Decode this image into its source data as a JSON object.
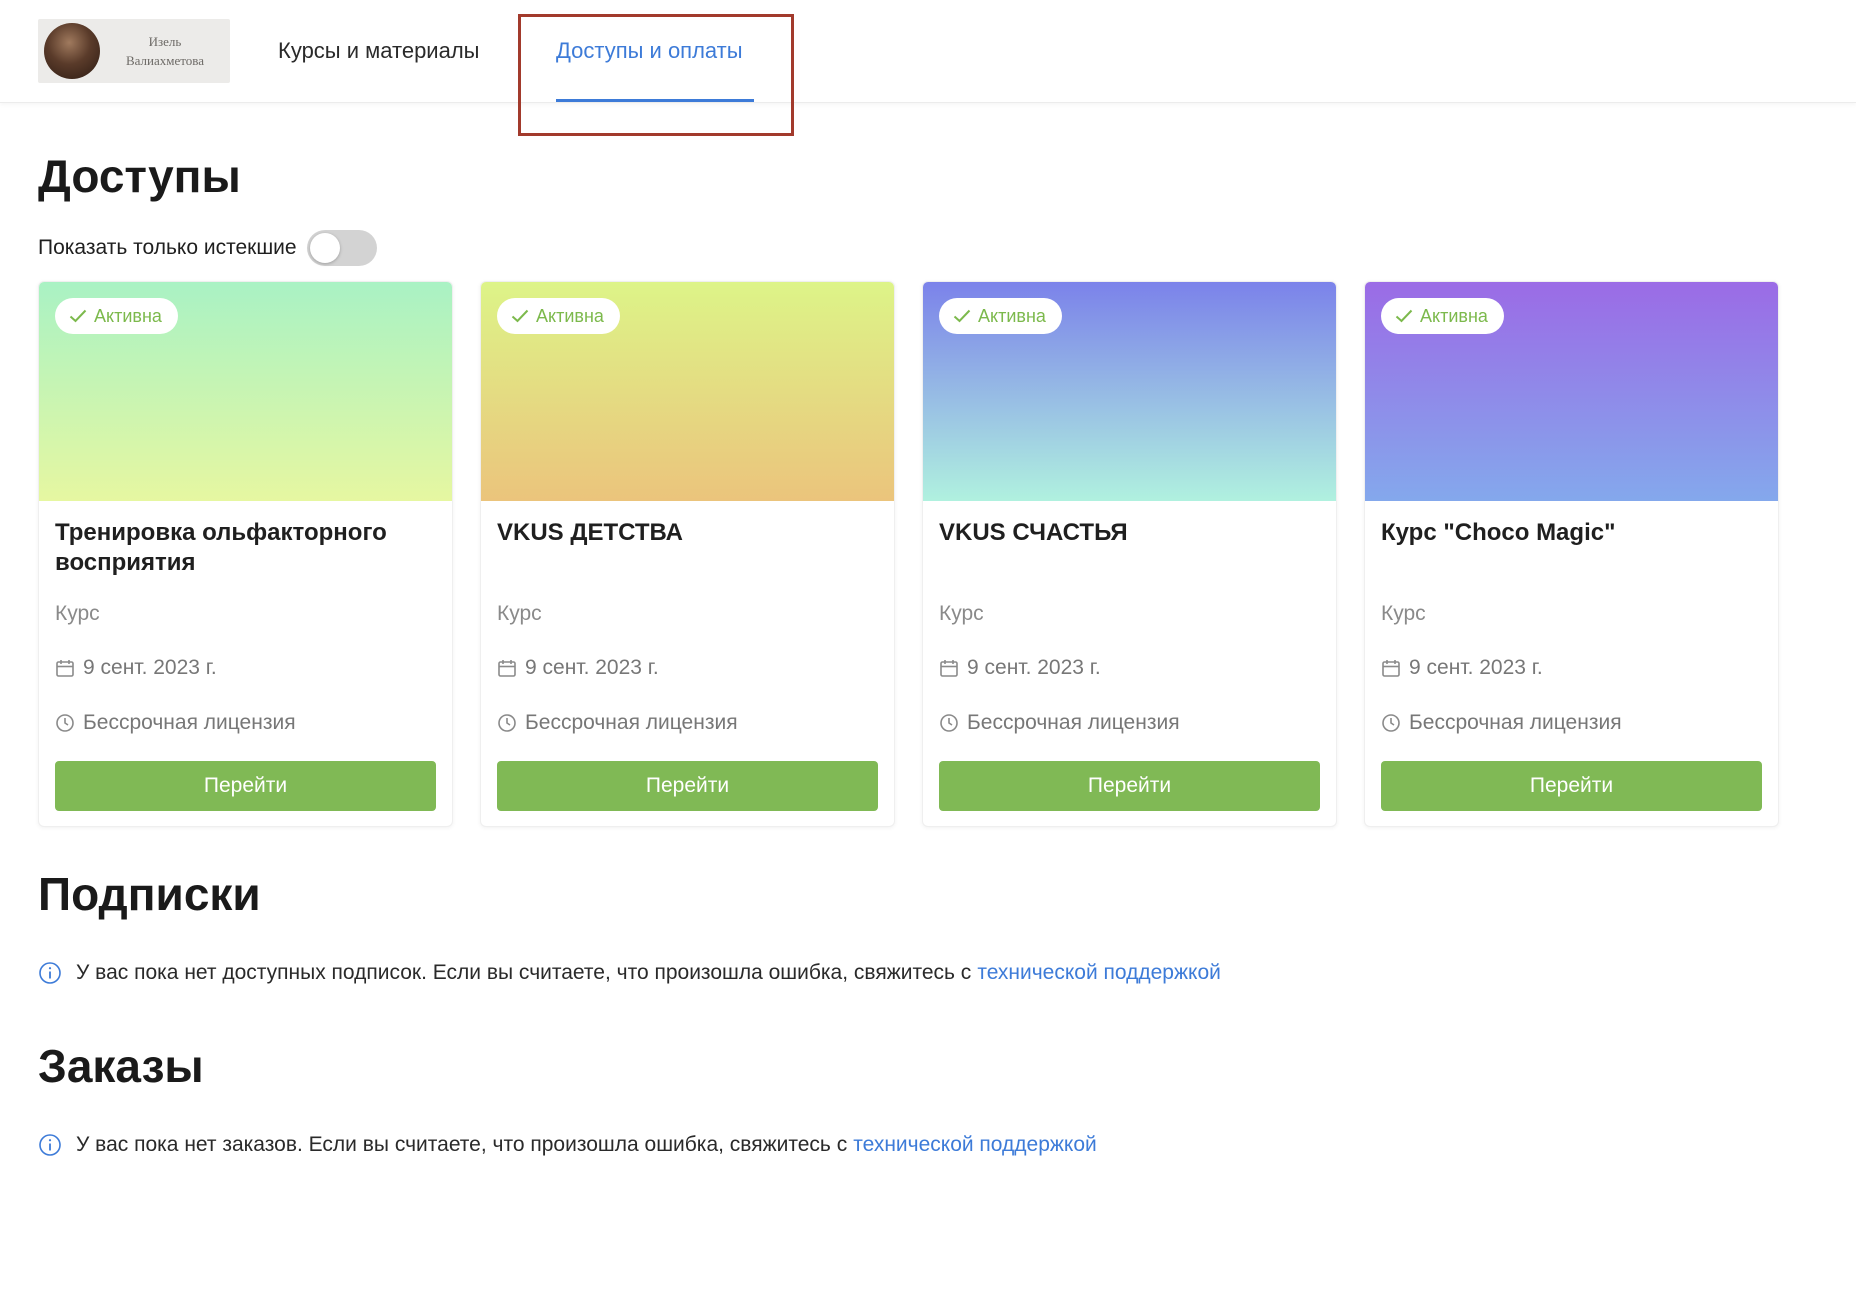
{
  "header": {
    "logo_line1": "Изель",
    "logo_line2": "Валиахметова",
    "tabs": [
      {
        "label": "Курсы и материалы"
      },
      {
        "label": "Доступы и оплаты"
      }
    ]
  },
  "access": {
    "title": "Доступы",
    "toggle_label": "Показать только истекшие",
    "toggle_on": false,
    "cards": [
      {
        "badge": "Активна",
        "title": "Тренировка ольфакторного восприятия",
        "type": "Курс",
        "date": "9 сент. 2023 г.",
        "license": "Бессрочная лицензия",
        "button": "Перейти",
        "gradient_top": "#a9f2c4",
        "gradient_bottom": "#e6f7a1"
      },
      {
        "badge": "Активна",
        "title": "VKUS ДЕТСТВА",
        "type": "Курс",
        "date": "9 сент. 2023 г.",
        "license": "Бессрочная лицензия",
        "button": "Перейти",
        "gradient_top": "#ddf488",
        "gradient_bottom": "#ebc47c"
      },
      {
        "badge": "Активна",
        "title": "VKUS СЧАСТЬЯ",
        "type": "Курс",
        "date": "9 сент. 2023 г.",
        "license": "Бессрочная лицензия",
        "button": "Перейти",
        "gradient_top": "#7b82ea",
        "gradient_bottom": "#b0f1df"
      },
      {
        "badge": "Активна",
        "title": "Курс \"Choco Magic\"",
        "type": "Курс",
        "date": "9 сент. 2023 г.",
        "license": "Бессрочная лицензия",
        "button": "Перейти",
        "gradient_top": "#9b6be6",
        "gradient_bottom": "#84a8ec"
      }
    ]
  },
  "subscriptions": {
    "title": "Подписки",
    "message": "У вас пока нет доступных подписок. Если вы считаете, что произошла ошибка, свяжитесь с",
    "link": "технической поддержкой"
  },
  "orders": {
    "title": "Заказы",
    "message": "У вас пока нет заказов. Если вы считаете, что произошла ошибка, свяжитесь с",
    "link": "технической поддержкой"
  },
  "colors": {
    "accent_blue": "#3d7bd8",
    "button_green": "#80b955",
    "badge_green": "#7cb94c",
    "highlight_red": "#a23a2c"
  }
}
